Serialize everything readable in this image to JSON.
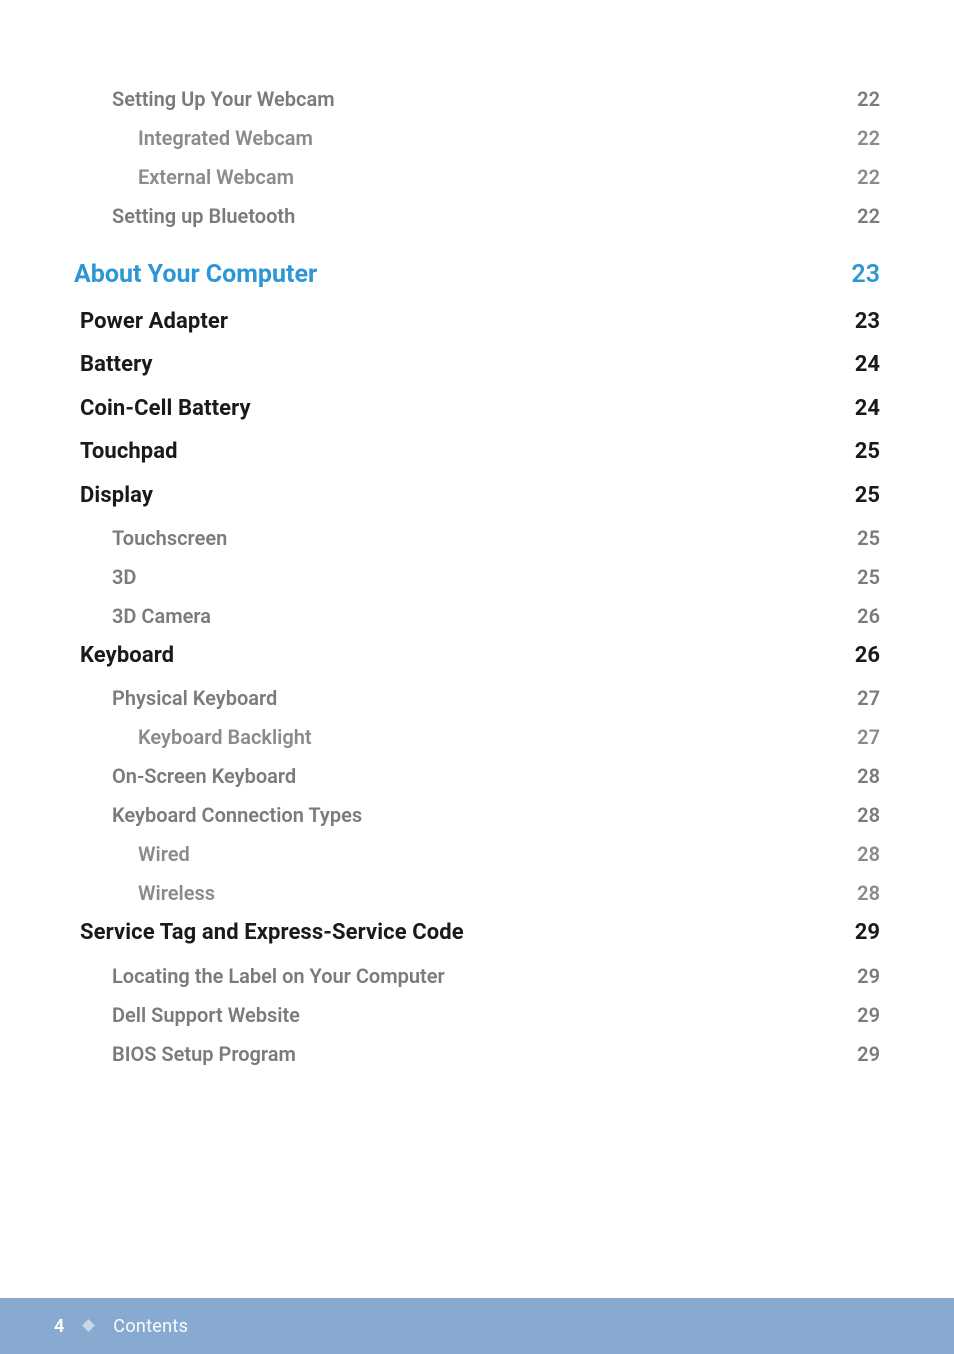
{
  "toc": {
    "items": [
      {
        "label": "Setting Up Your Webcam",
        "page": "22",
        "level": "l2"
      },
      {
        "label": "Integrated Webcam",
        "page": "22",
        "level": "l3"
      },
      {
        "label": "External Webcam",
        "page": "22",
        "level": "l3"
      },
      {
        "label": "Setting up Bluetooth",
        "page": "22",
        "level": "l2"
      },
      {
        "label": "About Your Computer",
        "page": "23",
        "level": "chapter"
      },
      {
        "label": "Power Adapter",
        "page": "23",
        "level": "l1"
      },
      {
        "label": "Battery",
        "page": "24",
        "level": "l1"
      },
      {
        "label": "Coin-Cell Battery",
        "page": "24",
        "level": "l1"
      },
      {
        "label": "Touchpad",
        "page": "25",
        "level": "l1"
      },
      {
        "label": "Display",
        "page": "25",
        "level": "l1"
      },
      {
        "label": "Touchscreen",
        "page": "25",
        "level": "l2"
      },
      {
        "label": "3D",
        "page": "25",
        "level": "l2"
      },
      {
        "label": "3D Camera",
        "page": "26",
        "level": "l2"
      },
      {
        "label": "Keyboard",
        "page": "26",
        "level": "l1"
      },
      {
        "label": "Physical Keyboard",
        "page": "27",
        "level": "l2"
      },
      {
        "label": "Keyboard Backlight",
        "page": "27",
        "level": "l3"
      },
      {
        "label": "On-Screen Keyboard",
        "page": "28",
        "level": "l2"
      },
      {
        "label": "Keyboard Connection Types",
        "page": "28",
        "level": "l2"
      },
      {
        "label": "Wired",
        "page": "28",
        "level": "l3"
      },
      {
        "label": "Wireless",
        "page": "28",
        "level": "l3"
      },
      {
        "label": "Service Tag and Express-Service Code",
        "page": "29",
        "level": "l1"
      },
      {
        "label": "Locating the Label on Your Computer",
        "page": "29",
        "level": "l2"
      },
      {
        "label": "Dell Support Website",
        "page": "29",
        "level": "l2"
      },
      {
        "label": "BIOS Setup Program",
        "page": "29",
        "level": "l2"
      }
    ]
  },
  "footer": {
    "page_number": "4",
    "label": "Contents"
  }
}
